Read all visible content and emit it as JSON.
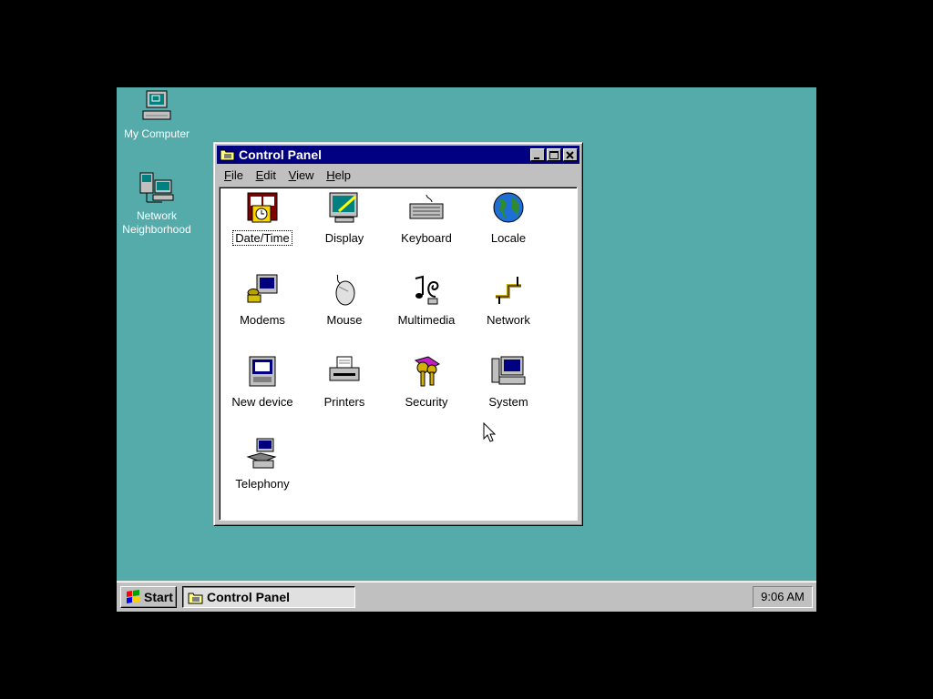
{
  "desktop": {
    "icons": [
      {
        "label": "My Computer",
        "icon": "my-computer-icon"
      },
      {
        "label": "Network\nNeighborhood",
        "icon": "network-neighborhood-icon"
      }
    ]
  },
  "window": {
    "title": "Control Panel",
    "menu": [
      {
        "label": "File",
        "hotkey": "F",
        "rest": "ile"
      },
      {
        "label": "Edit",
        "hotkey": "E",
        "rest": "dit"
      },
      {
        "label": "View",
        "hotkey": "V",
        "rest": "iew"
      },
      {
        "label": "Help",
        "hotkey": "H",
        "rest": "elp"
      }
    ],
    "items": [
      {
        "label": "Date/Time",
        "icon": "date-time-icon",
        "focused": true
      },
      {
        "label": "Display",
        "icon": "display-icon"
      },
      {
        "label": "Keyboard",
        "icon": "keyboard-icon"
      },
      {
        "label": "Locale",
        "icon": "globe-icon"
      },
      {
        "label": "Modems",
        "icon": "modem-icon"
      },
      {
        "label": "Mouse",
        "icon": "mouse-icon"
      },
      {
        "label": "Multimedia",
        "icon": "multimedia-icon"
      },
      {
        "label": "Network",
        "icon": "network-icon"
      },
      {
        "label": "New device",
        "icon": "new-device-icon"
      },
      {
        "label": "Printers",
        "icon": "printer-icon"
      },
      {
        "label": "Security",
        "icon": "keys-icon"
      },
      {
        "label": "System",
        "icon": "system-icon"
      },
      {
        "label": "Telephony",
        "icon": "telephony-icon"
      }
    ]
  },
  "taskbar": {
    "start_label": "Start",
    "task_label": "Control Panel",
    "clock": "9:06 AM"
  },
  "colors": {
    "desktop": "#55aaaa",
    "titlebar": "#000080",
    "face": "#c0c0c0"
  }
}
